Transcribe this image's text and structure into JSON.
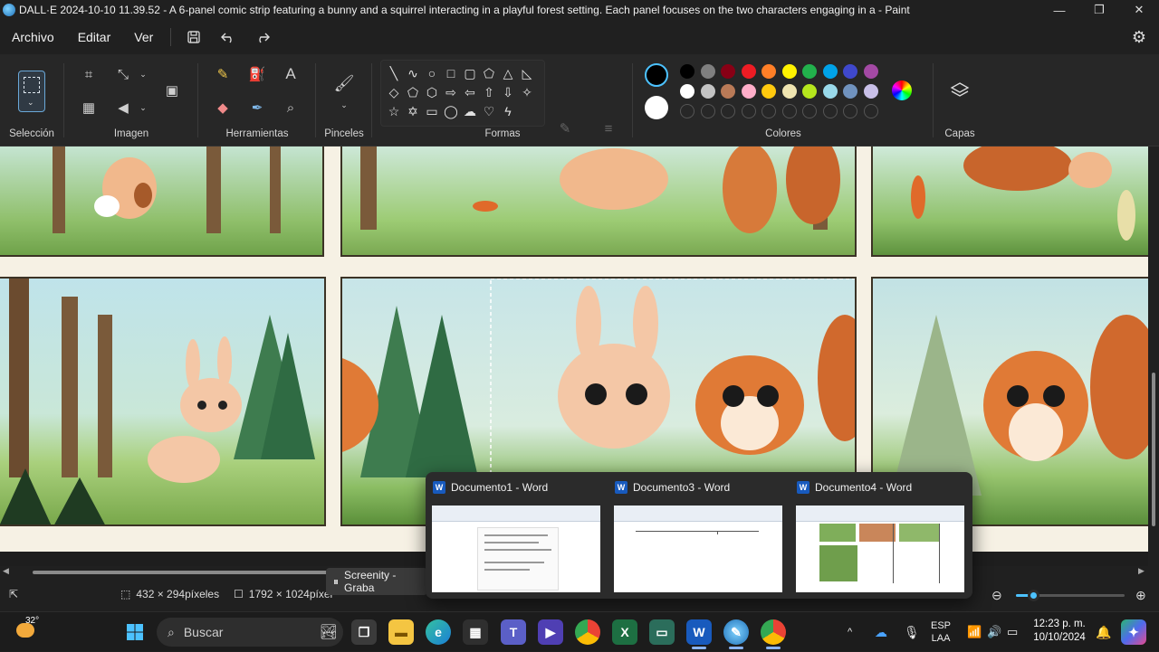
{
  "window": {
    "title": "DALL·E 2024-10-10 11.39.52 - A 6-panel comic strip featuring a bunny and a squirrel interacting in a playful forest setting. Each panel focuses on the two characters engaging in a - Paint",
    "minimize": "—",
    "maximize": "❐",
    "close": "✕"
  },
  "menu": {
    "items": [
      "Archivo",
      "Editar",
      "Ver"
    ],
    "save_icon": "save-icon",
    "undo_icon": "undo-icon",
    "redo_icon": "redo-icon",
    "settings_icon": "gear-icon"
  },
  "ribbon": {
    "groups": {
      "seleccion": "Selección",
      "imagen": "Imagen",
      "herramientas": "Herramientas",
      "pinceles": "Pinceles",
      "formas": "Formas",
      "colores": "Colores",
      "capas": "Capas"
    },
    "primary_color": "#000000",
    "secondary_color": "#ffffff",
    "palette_row1": [
      "#000000",
      "#7f7f7f",
      "#880015",
      "#ed1c24",
      "#ff7f27",
      "#fff200",
      "#22b14c",
      "#00a2e8",
      "#3f48cc",
      "#a349a4"
    ],
    "palette_row2": [
      "#ffffff",
      "#c3c3c3",
      "#b97a57",
      "#ffaec9",
      "#ffc90e",
      "#efe4b0",
      "#b5e61d",
      "#99d9ea",
      "#7092be",
      "#c8bfe7"
    ]
  },
  "status": {
    "selection_size": "432 × 294píxeles",
    "image_size": "1792 × 1024píxel",
    "zoom_level": 0.16
  },
  "screenity": {
    "label": "Screenity - Graba"
  },
  "preview": {
    "windows": [
      {
        "title": "Documento1 - Word"
      },
      {
        "title": "Documento3 - Word"
      },
      {
        "title": "Documento4 - Word"
      }
    ]
  },
  "taskbar": {
    "weather": "32°",
    "search_placeholder": "Buscar",
    "language_top": "ESP",
    "language_bottom": "LAA",
    "time": "12:23 p. m.",
    "date": "10/10/2024"
  }
}
